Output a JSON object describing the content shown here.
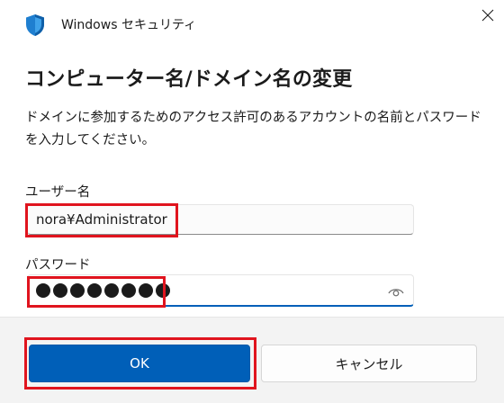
{
  "window": {
    "title": "Windows セキュリティ",
    "icon": "shield-icon"
  },
  "dialog": {
    "heading": "コンピューター名/ドメイン名の変更",
    "description": "ドメインに参加するためのアクセス許可のあるアカウントの名前とパスワードを入力してください。"
  },
  "fields": {
    "username_label": "ユーザー名",
    "username_value": "nora¥Administrator",
    "password_label": "パスワード",
    "password_mask_count": 8
  },
  "buttons": {
    "ok_label": "OK",
    "cancel_label": "キャンセル"
  },
  "colors": {
    "accent": "#005fb8",
    "highlight": "#e0141e",
    "footer_bg": "#f3f3f3"
  }
}
